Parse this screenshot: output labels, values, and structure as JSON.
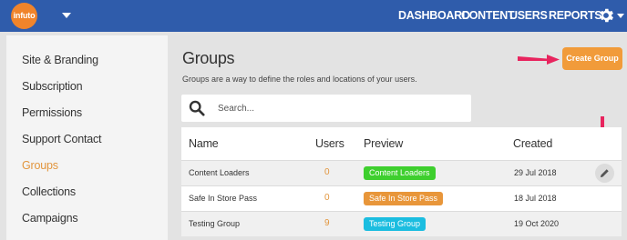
{
  "brand": {
    "logo_text": "infuto"
  },
  "nav": {
    "items": [
      "DASHBOARD",
      "CONTENT",
      "USERS",
      "REPORTS"
    ]
  },
  "sidebar": {
    "items": [
      {
        "label": "Site & Branding"
      },
      {
        "label": "Subscription"
      },
      {
        "label": "Permissions"
      },
      {
        "label": "Support Contact"
      },
      {
        "label": "Groups",
        "active": true
      },
      {
        "label": "Collections"
      },
      {
        "label": "Campaigns"
      }
    ]
  },
  "main": {
    "title": "Groups",
    "subtitle": "Groups are a way to define the roles and locations of your users.",
    "create_button": "Create Group",
    "search": {
      "placeholder": "Search..."
    },
    "table": {
      "headers": {
        "name": "Name",
        "users": "Users",
        "preview": "Preview",
        "created": "Created"
      },
      "rows": [
        {
          "name": "Content Loaders",
          "users": "0",
          "preview": "Content Loaders",
          "badge_color": "#3ecf2e",
          "created": "29 Jul 2018"
        },
        {
          "name": "Safe In Store Pass",
          "users": "0",
          "preview": "Safe In Store Pass",
          "badge_color": "#e8963a",
          "created": "18 Jul 2018"
        },
        {
          "name": "Testing Group",
          "users": "9",
          "preview": "Testing Group",
          "badge_color": "#1bbde0",
          "created": "19 Oct 2020"
        }
      ]
    }
  },
  "colors": {
    "topbar": "#2f5cab",
    "accent": "#f19b3a",
    "annotation_arrow": "#e8245e"
  },
  "icons": {
    "settings": "gear-icon",
    "search": "search-icon",
    "edit": "pencil-icon"
  }
}
